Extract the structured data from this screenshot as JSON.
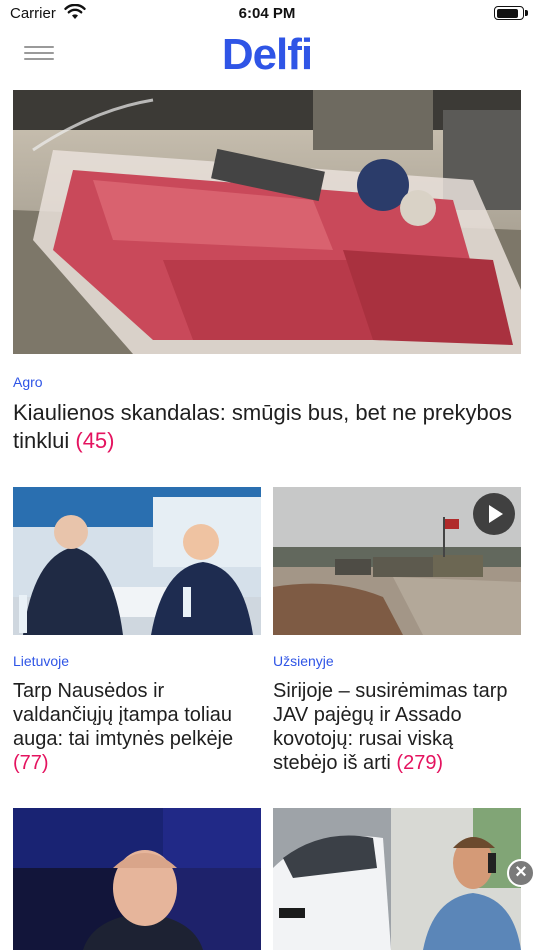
{
  "status_bar": {
    "carrier": "Carrier",
    "time": "6:04 PM",
    "battery_level": 0.9
  },
  "nav": {
    "logo": "Delfi",
    "menu_icon": "hamburger-menu-icon"
  },
  "articles": [
    {
      "category": "Agro",
      "headline": "Kiaulienos skandalas: smūgis bus, bet ne prekybos tinklui",
      "comments": "(45)",
      "image": "meat-counter-photo"
    },
    {
      "category": "Lietuvoje",
      "headline": "Tarp Nausėdos ir valdančiųjų įtampa toliau auga: tai imtynės pelkėje",
      "comments": "(77)",
      "image": "politicians-debate-photo"
    },
    {
      "category": "Užsienyje",
      "headline": "Sirijoje – susirėmimas tarp JAV pajėgų ir Assado kovotojų: rusai viską stebėjo iš arti",
      "comments": "(279)",
      "image": "military-convoy-photo",
      "video": true
    },
    {
      "image": "politician-portrait-photo"
    },
    {
      "image": "car-and-man-on-phone-photo"
    }
  ],
  "colors": {
    "brand": "#2f55e6",
    "comment_count": "#e4135f"
  }
}
